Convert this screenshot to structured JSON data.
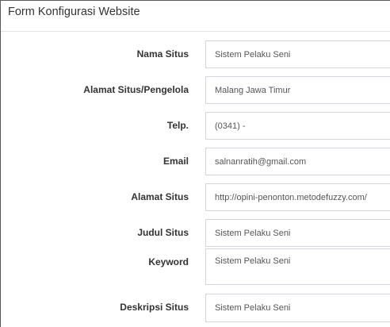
{
  "panel": {
    "title": "Form Konfigurasi Website"
  },
  "form": {
    "fields": [
      {
        "label": "Nama Situs",
        "value": "Sistem Pelaku Seni"
      },
      {
        "label": "Alamat Situs/Pengelola",
        "value": "Malang Jawa Timur"
      },
      {
        "label": "Telp.",
        "value": "(0341) -"
      },
      {
        "label": "Email",
        "value": "salnanratih@gmail.com"
      },
      {
        "label": "Alamat Situs",
        "value": "http://opini-penonton.metodefuzzy.com/"
      },
      {
        "label": "Judul Situs",
        "value": "Sistem Pelaku Seni"
      },
      {
        "label": "Keyword",
        "value": "Sistem Pelaku Seni"
      },
      {
        "label": "Deskripsi Situs",
        "value": "Sistem Pelaku Seni"
      }
    ]
  }
}
